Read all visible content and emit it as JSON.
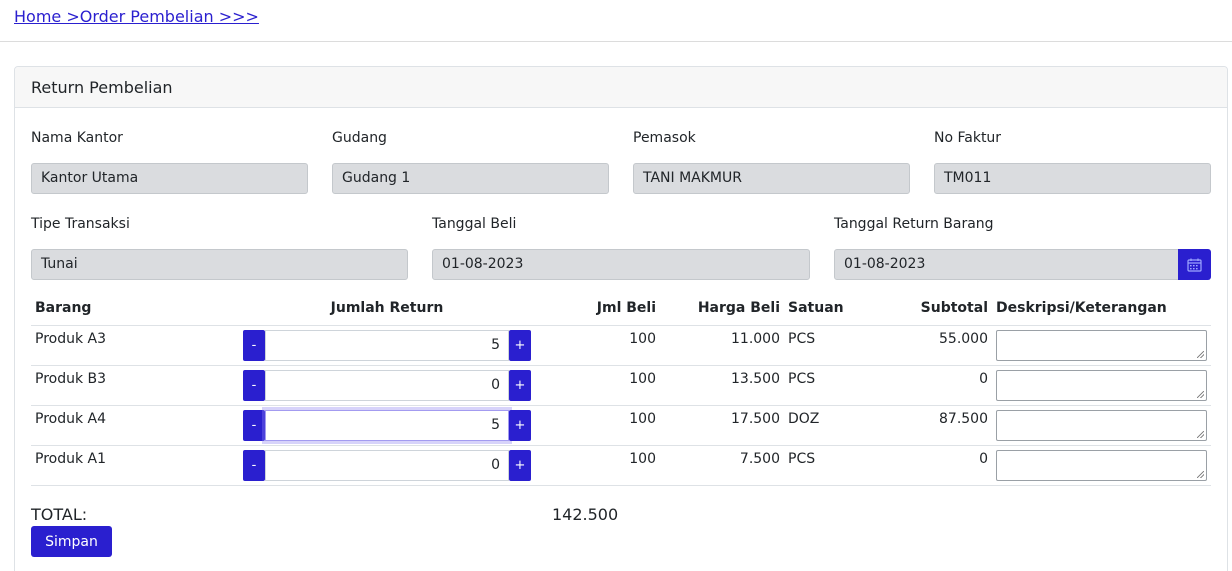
{
  "breadcrumb": "Home >Order Pembelian >>>",
  "card_title": "Return Pembelian",
  "fields": {
    "nama_kantor": {
      "label": "Nama Kantor",
      "value": "Kantor Utama"
    },
    "gudang": {
      "label": "Gudang",
      "value": "Gudang 1"
    },
    "pemasok": {
      "label": "Pemasok",
      "value": "TANI MAKMUR"
    },
    "no_faktur": {
      "label": "No Faktur",
      "value": "TM011"
    },
    "tipe_transaksi": {
      "label": "Tipe Transaksi",
      "value": "Tunai"
    },
    "tanggal_beli": {
      "label": "Tanggal Beli",
      "value": "01-08-2023"
    },
    "tanggal_return": {
      "label": "Tanggal Return Barang",
      "value": "01-08-2023"
    }
  },
  "table": {
    "headers": {
      "barang": "Barang",
      "jumlah_return": "Jumlah Return",
      "jml_beli": "Jml Beli",
      "harga_beli": "Harga Beli",
      "satuan": "Satuan",
      "subtotal": "Subtotal",
      "deskripsi": "Deskripsi/Keterangan"
    },
    "minus_label": "-",
    "plus_label": "+",
    "rows": [
      {
        "barang": "Produk A3",
        "jumlah_return": "5",
        "jml_beli": "100",
        "harga_beli": "11.000",
        "satuan": "PCS",
        "subtotal": "55.000"
      },
      {
        "barang": "Produk B3",
        "jumlah_return": "0",
        "jml_beli": "100",
        "harga_beli": "13.500",
        "satuan": "PCS",
        "subtotal": "0"
      },
      {
        "barang": "Produk A4",
        "jumlah_return": "5",
        "jml_beli": "100",
        "harga_beli": "17.500",
        "satuan": "DOZ",
        "subtotal": "87.500"
      },
      {
        "barang": "Produk A1",
        "jumlah_return": "0",
        "jml_beli": "100",
        "harga_beli": "7.500",
        "satuan": "PCS",
        "subtotal": "0"
      }
    ]
  },
  "total_label": "TOTAL:",
  "total_value": "142.500",
  "save_label": "Simpan",
  "colors": {
    "accent": "#2a1fcf",
    "readonly_bg": "#dadcdf"
  }
}
